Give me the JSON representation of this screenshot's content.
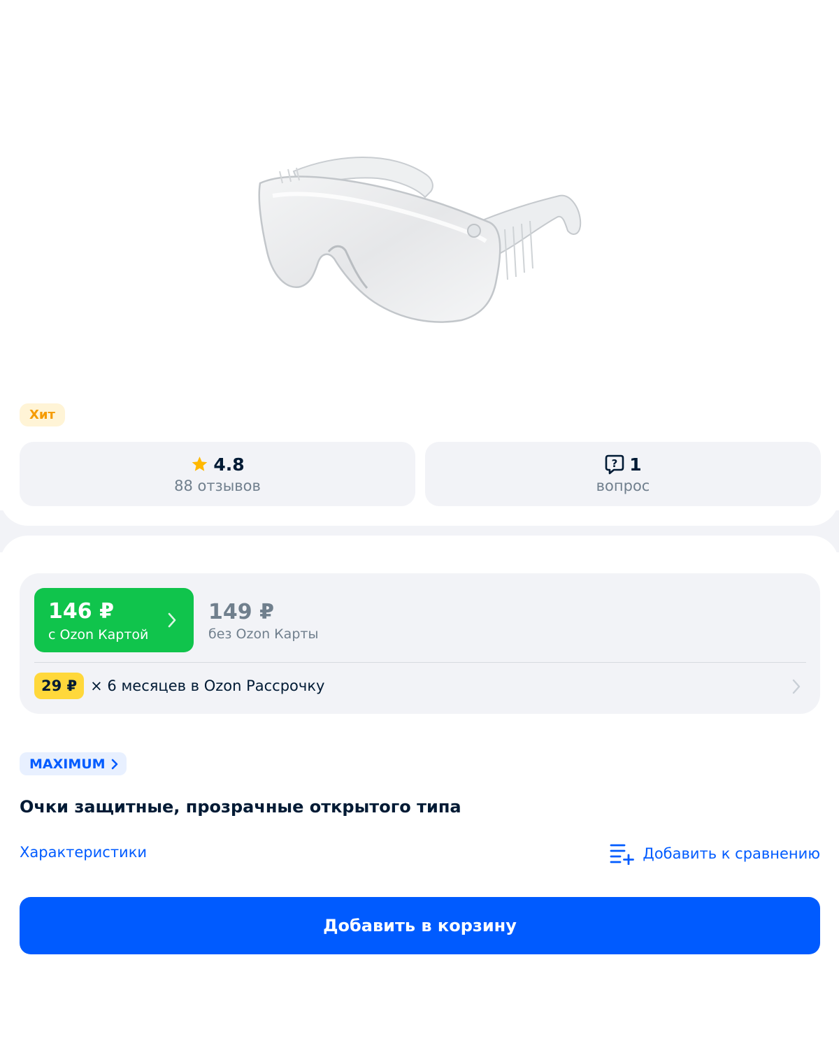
{
  "badges": {
    "hit": "Хит"
  },
  "rating": {
    "value": "4.8",
    "reviews_label": "88 отзывов"
  },
  "questions": {
    "count": "1",
    "label": "вопрос"
  },
  "price": {
    "ozon_card_price": "146 ₽",
    "ozon_card_label": "с Ozon Картой",
    "regular_price": "149 ₽",
    "regular_label": "без Ozon Карты",
    "installment_amount": "29 ₽",
    "installment_text": "× 6 месяцев в Ozon Рассрочку"
  },
  "brand": {
    "name": "MAXIMUM"
  },
  "product": {
    "title": "Очки защитные, прозрачные открытого типа"
  },
  "links": {
    "specs": "Характеристики",
    "compare": "Добавить к сравнению"
  },
  "actions": {
    "add_to_cart": "Добавить в корзину"
  },
  "colors": {
    "accent": "#005bff",
    "ozon_green": "#10c44c",
    "installment_yellow": "#ffd83b",
    "hit_badge_bg": "#fff4d6",
    "hit_badge_text": "#f59b00",
    "panel_bg": "#f2f3f7"
  },
  "icons": {
    "rating": "star-icon",
    "questions": "question-bubble-icon",
    "chevron": "chevron-right-icon",
    "compare": "compare-list-icon"
  }
}
